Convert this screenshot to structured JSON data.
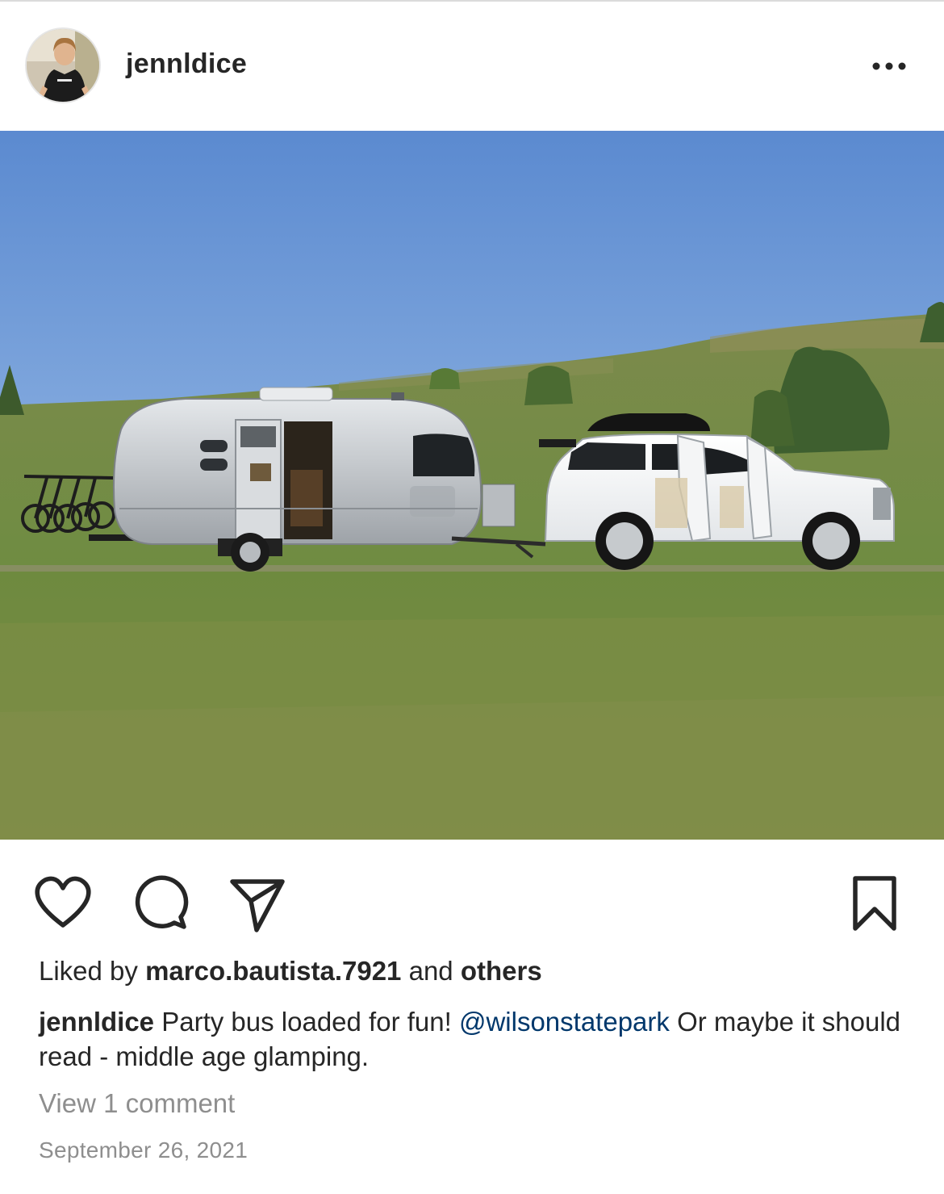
{
  "post": {
    "username": "jennldice",
    "icons": {
      "more": "more-horizontal-icon",
      "like": "heart-icon",
      "comment": "comment-bubble-icon",
      "share": "paper-plane-icon",
      "save": "bookmark-icon"
    },
    "likes": {
      "prefix": "Liked by",
      "user": "marco.bautista.7921",
      "joiner": "and",
      "others": "others"
    },
    "caption": {
      "username": "jennldice",
      "text_before": "Party bus loaded for fun!",
      "mention": "@wilsonstatepark",
      "text_after": "Or maybe it should read - middle age glamping."
    },
    "view_comments": "View 1 comment",
    "date": "September 26, 2021"
  },
  "colors": {
    "text": "#262626",
    "secondary": "#8e8e8e",
    "mention": "#00376b",
    "divider": "#dbdbdb"
  }
}
